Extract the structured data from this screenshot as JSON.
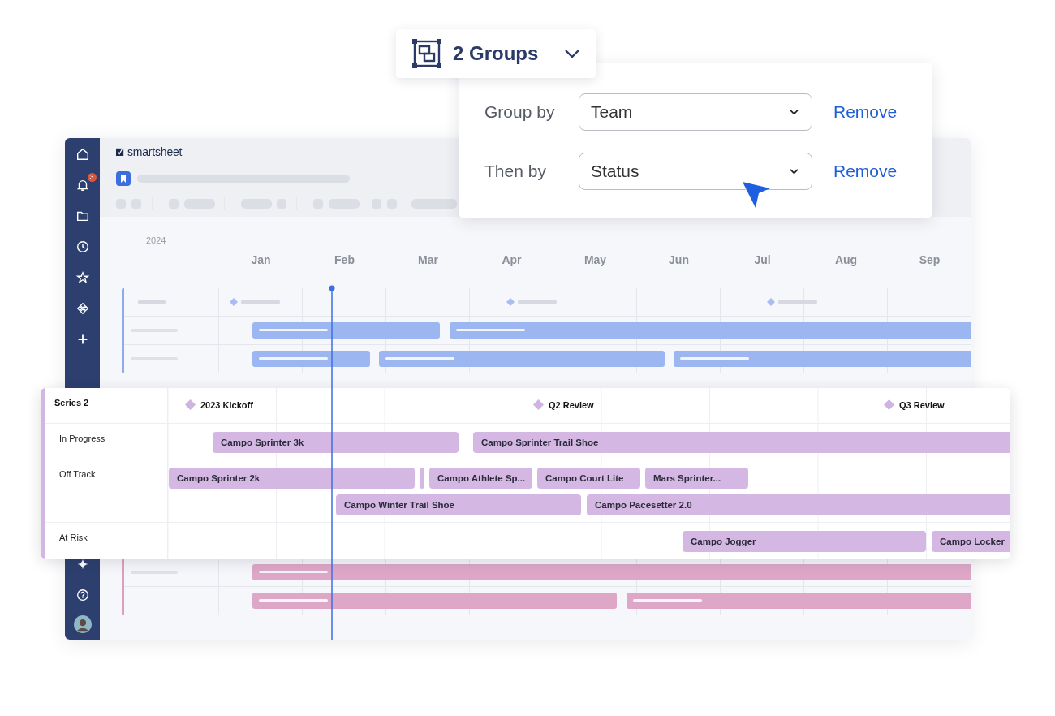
{
  "groups_button": {
    "label": "2 Groups"
  },
  "group_panel": {
    "rows": [
      {
        "label": "Group by",
        "value": "Team",
        "action": "Remove"
      },
      {
        "label": "Then by",
        "value": "Status",
        "action": "Remove"
      }
    ]
  },
  "app": {
    "logo": "smartsheet",
    "notification_badge": "3"
  },
  "timeline": {
    "year": "2024",
    "months": [
      "Jan",
      "Feb",
      "Mar",
      "Apr",
      "May",
      "Jun",
      "Jul",
      "Aug",
      "Sep"
    ]
  },
  "series_card": {
    "title": "Series 2",
    "milestones": [
      "2023 Kickoff",
      "Q2 Review",
      "Q3 Review"
    ],
    "rows": [
      {
        "label": "In Progress",
        "lanes": [
          [
            {
              "kind": "task",
              "label": "Campo Sprinter 3k"
            },
            {
              "kind": "task",
              "label": "Campo Sprinter Trail Shoe"
            }
          ]
        ]
      },
      {
        "label": "Off Track",
        "lanes": [
          [
            {
              "kind": "task",
              "label": "Campo Sprinter 2k"
            },
            {
              "kind": "sliver"
            },
            {
              "kind": "task",
              "label": "Campo Athlete Sp..."
            },
            {
              "kind": "task",
              "label": "Campo Court Lite"
            },
            {
              "kind": "task",
              "label": "Mars Sprinter..."
            }
          ],
          [
            {
              "kind": "task",
              "label": "Campo Winter Trail Shoe"
            },
            {
              "kind": "task",
              "label": "Campo Pacesetter 2.0"
            }
          ]
        ]
      },
      {
        "label": "At Risk",
        "lanes": [
          [
            {
              "kind": "task",
              "label": "Campo Jogger"
            },
            {
              "kind": "task",
              "label": "Campo Locker"
            }
          ]
        ]
      }
    ]
  }
}
